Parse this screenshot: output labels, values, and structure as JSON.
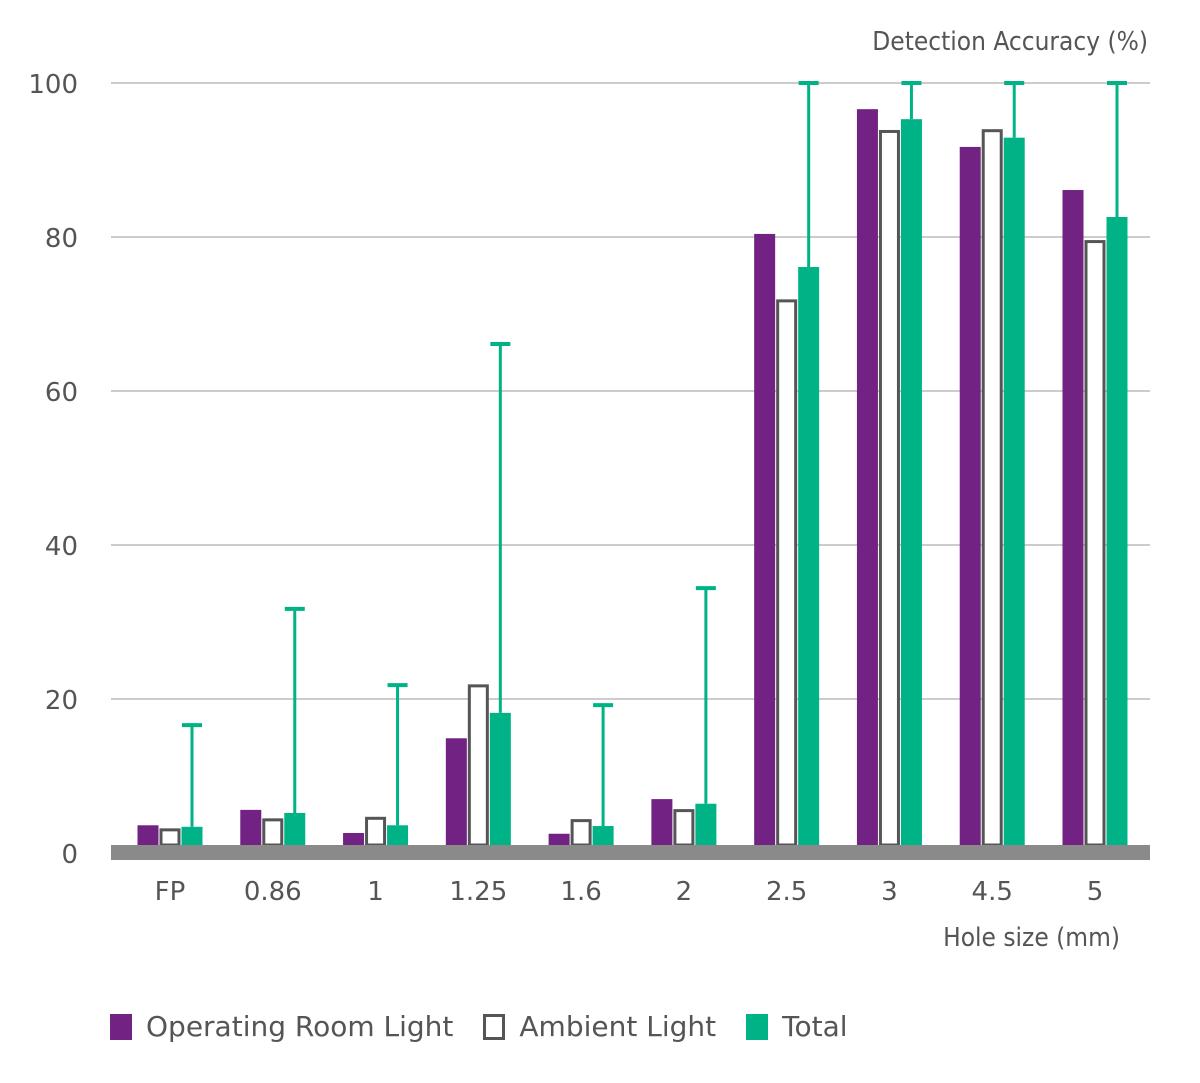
{
  "chart_data": {
    "type": "bar",
    "title": "",
    "ylabel": "Detection Accuracy (%)",
    "xlabel": "Hole size (mm)",
    "ylim": [
      0,
      100
    ],
    "yticks": [
      0,
      20,
      40,
      60,
      80,
      100
    ],
    "grid": true,
    "legend_position": "bottom-left",
    "categories": [
      "FP",
      "0.86",
      "1",
      "1.25",
      "1.6",
      "2",
      "2.5",
      "3",
      "4.5",
      "5"
    ],
    "series": [
      {
        "name": "Operating Room Light",
        "style": "filled",
        "color": "#722282",
        "values": [
          3.6,
          5.6,
          2.6,
          14.9,
          2.5,
          7.0,
          80.4,
          96.6,
          91.7,
          86.1
        ]
      },
      {
        "name": "Ambient Light",
        "style": "outline",
        "color": "#555555",
        "values": [
          3.2,
          4.5,
          4.7,
          21.9,
          4.4,
          5.7,
          71.9,
          93.9,
          94.0,
          79.6
        ]
      },
      {
        "name": "Total",
        "style": "filled",
        "color": "#00b386",
        "values": [
          3.4,
          5.2,
          3.6,
          18.2,
          3.5,
          6.4,
          76.1,
          95.3,
          92.9,
          82.6
        ],
        "error_upper": [
          16.6,
          31.7,
          21.8,
          66.1,
          19.2,
          34.4,
          100,
          100,
          100,
          100
        ]
      }
    ]
  },
  "colors": {
    "grid": "#cccccc",
    "baseline": "#8a8a8a",
    "text": "#555555"
  }
}
